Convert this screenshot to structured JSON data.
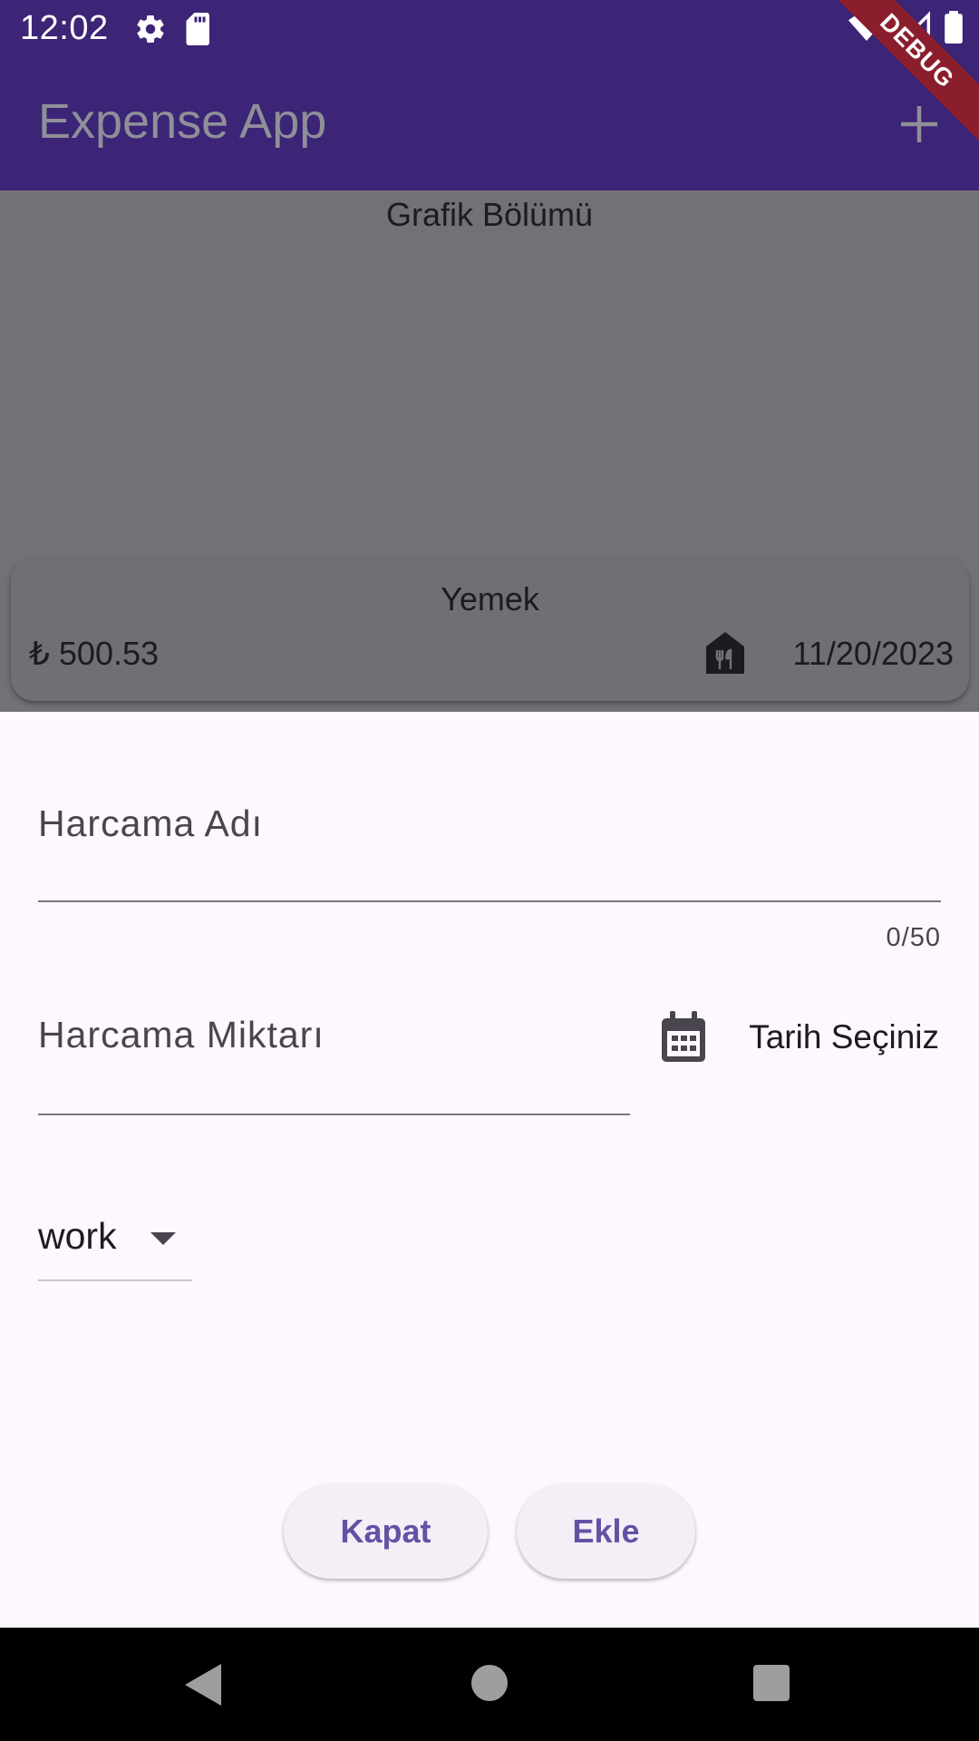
{
  "status_bar": {
    "time": "12:02",
    "icons": [
      "settings-icon",
      "sd-card-icon",
      "wifi-icon",
      "signal-icon",
      "battery-icon"
    ]
  },
  "app_bar": {
    "title": "Expense App",
    "add_icon": "plus-icon"
  },
  "debug_banner": "DEBUG",
  "chart_section": {
    "title": "Grafik Bölümü"
  },
  "expense_item": {
    "title": "Yemek",
    "amount": "₺ 500.53",
    "category_icon": "food-icon",
    "date": "11/20/2023"
  },
  "form": {
    "name_label": "Harcama Adı",
    "name_value": "",
    "name_counter": "0/50",
    "amount_label": "Harcama Miktarı",
    "amount_value": "",
    "date_icon": "calendar-icon",
    "date_button_label": "Tarih Seçiniz",
    "category_selected": "work",
    "close_button": "Kapat",
    "add_button": "Ekle"
  },
  "colors": {
    "app_bar": "#3c2476",
    "scrim": "#737175",
    "sheet": "#fef7ff",
    "button_text": "#6650a4",
    "debug_banner": "#8b1e2d"
  },
  "nav_bar": {
    "icons": [
      "back-icon",
      "home-icon",
      "recents-icon"
    ]
  }
}
